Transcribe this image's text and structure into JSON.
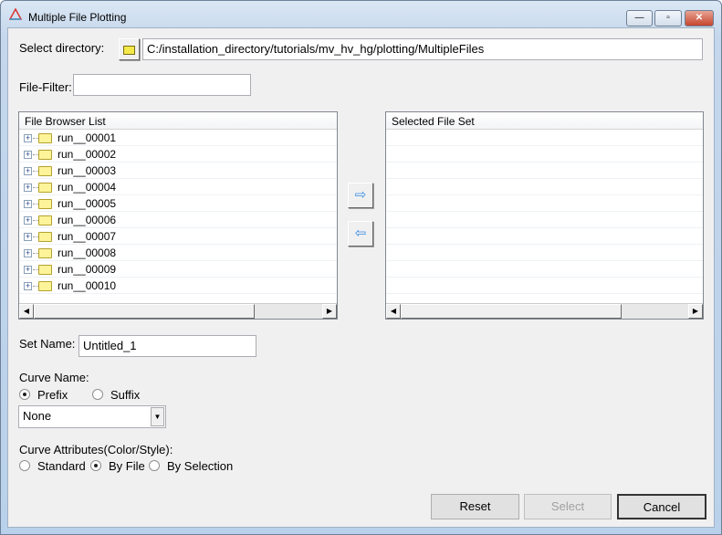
{
  "window": {
    "title": "Multiple File Plotting",
    "minimize": "—",
    "maximize": "▫",
    "close": "✕"
  },
  "directory": {
    "label": "Select directory:",
    "value": "C:/installation_directory/tutorials/mv_hv_hg/plotting/MultipleFiles"
  },
  "filter": {
    "label": "File-Filter:",
    "value": ""
  },
  "file_browser": {
    "header": "File Browser List",
    "items": [
      "run__00001",
      "run__00002",
      "run__00003",
      "run__00004",
      "run__00005",
      "run__00006",
      "run__00007",
      "run__00008",
      "run__00009",
      "run__00010"
    ]
  },
  "selected_set": {
    "header": "Selected File Set"
  },
  "arrows": {
    "add": "⇨",
    "remove": "⇦"
  },
  "set_name": {
    "label": "Set Name:",
    "value": "Untitled_1"
  },
  "curve_name": {
    "label": "Curve Name:",
    "options": [
      "Prefix",
      "Suffix"
    ],
    "selected": "Prefix",
    "dropdown_value": "None"
  },
  "curve_attributes": {
    "label": "Curve Attributes(Color/Style):",
    "options": [
      "Standard",
      "By File",
      "By Selection"
    ],
    "selected": "By File"
  },
  "buttons": {
    "reset": "Reset",
    "select": "Select",
    "cancel": "Cancel"
  }
}
